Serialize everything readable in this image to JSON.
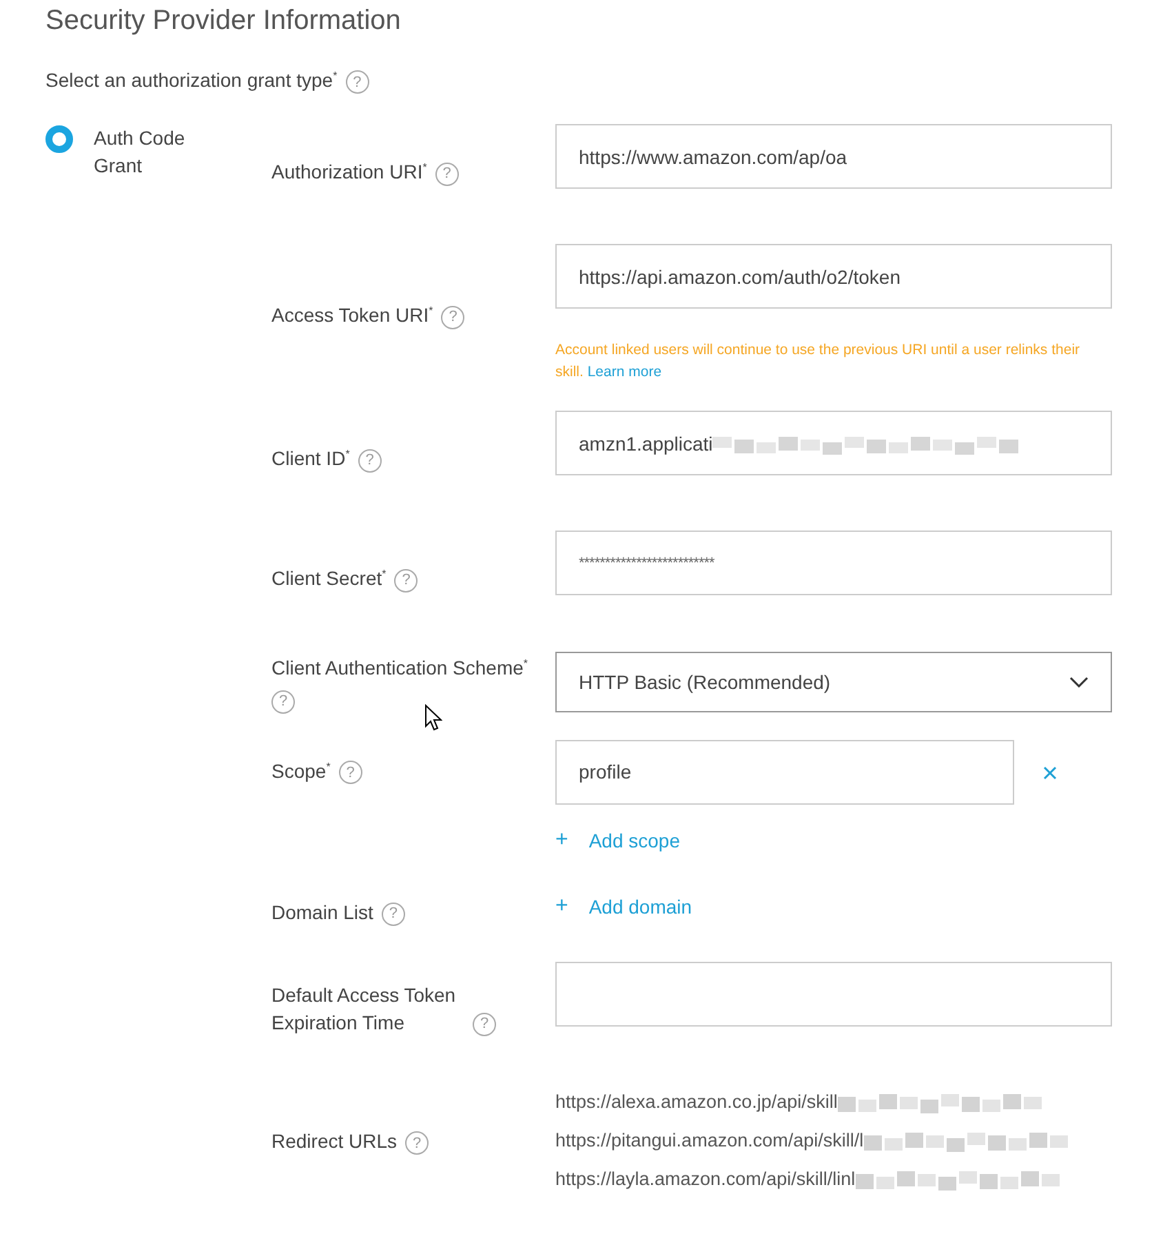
{
  "title": "Security Provider Information",
  "grant": {
    "label": "Select an authorization grant type$^{*}$",
    "help": "?",
    "options": [
      {
        "label": "Auth Code Grant",
        "selected": true
      }
    ]
  },
  "fields": [
    {
      "kind": "text",
      "label": "Authorization URI$^{*}$",
      "help": "?",
      "value": "https://www.amazon.com/ap/oa"
    },
    {
      "kind": "text",
      "label": "Access Token URI$^{*}$",
      "help": "?",
      "value": "https://api.amazon.com/auth/o2/token",
      "note": "Account linked users will continue to use the previous URI until a user relinks their skill.",
      "note_link": "Learn more"
    },
    {
      "kind": "text",
      "label": "Client ID$^{*}$",
      "help": "?",
      "value": "amzn1.applicati",
      "blurred": true
    },
    {
      "kind": "secret",
      "label": "Client Secret$^{*}$",
      "help": "?",
      "value": "**************************"
    },
    {
      "kind": "select",
      "label": "Client Authentication Scheme$^{*}$",
      "help": "?",
      "value": "HTTP Basic (Recommended)"
    },
    {
      "kind": "scope",
      "label": "Scope$^{*}$",
      "help": "?",
      "value": "profile",
      "add": "+",
      "add_label": "Add scope"
    },
    {
      "kind": "add",
      "label": "Domain List",
      "help": "?",
      "add": "+",
      "add_label": "Add domain"
    },
    {
      "kind": "text",
      "label": "Default Access Token Expiration Time",
      "help": "?"
    },
    {
      "kind": "urls",
      "label": "Redirect URLs",
      "help": "?",
      "urls": [
        "https://alexa.amazon.co.jp/api/skill",
        "https://pitangui.amazon.com/api/skill/l",
        "https://layla.amazon.com/api/skill/linl"
      ]
    }
  ]
}
